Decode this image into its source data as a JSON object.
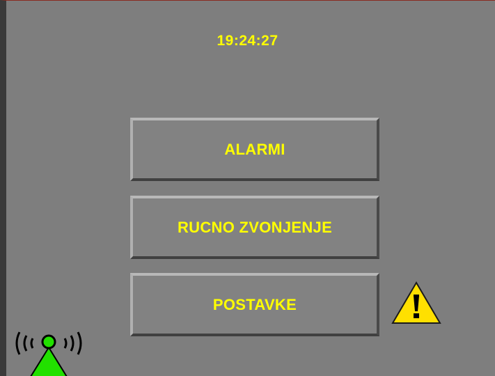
{
  "status": {
    "time": "19:24:27"
  },
  "menu": {
    "alarmi_label": "ALARMI",
    "rucno_label": "RUCNO ZVONJENJE",
    "postavke_label": "POSTAVKE"
  },
  "indicators": {
    "warning_icon": "warning-triangle-icon",
    "antenna_icon": "radio-antenna-icon"
  },
  "colors": {
    "background": "#7e7e7e",
    "text": "#ffff00",
    "warning_fill": "#ffe000",
    "antenna_fill": "#22e000"
  }
}
